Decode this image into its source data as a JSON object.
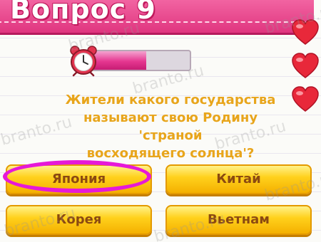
{
  "header": {
    "title": "Вопрос 9"
  },
  "timer": {
    "remaining_fraction": 0.55
  },
  "lives": {
    "count": 3,
    "icon": "heart-icon"
  },
  "question": {
    "text": "Жители какого государства\nназывают свою Родину 'страной\nвосходящего солнца'?"
  },
  "answers": [
    {
      "label": "Япония",
      "highlighted": true
    },
    {
      "label": "Китай"
    },
    {
      "label": "Корея"
    },
    {
      "label": "Вьетнам"
    }
  ],
  "watermark": {
    "text": "branto.ru"
  },
  "colors": {
    "header": "#e0357f",
    "question_text": "#e8a51b",
    "button": "#ffd11c",
    "button_text": "#8b4a11",
    "highlight": "#e619d8",
    "heart": "#e8283a"
  }
}
